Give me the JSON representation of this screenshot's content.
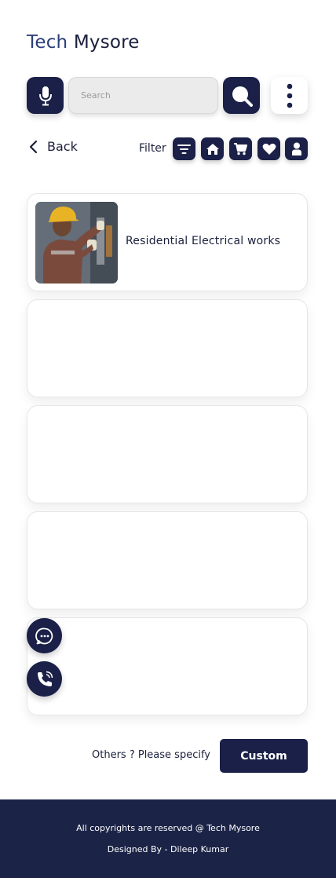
{
  "header": {
    "brand_part1": "Tech",
    "brand_part2": "Mysore"
  },
  "toolbar": {
    "mic_icon": "microphone-icon",
    "search_placeholder": "Search",
    "search_value": "",
    "search_icon": "search-icon",
    "more_icon": "vertical-dots-icon"
  },
  "nav": {
    "back_label": "Back",
    "filter_label": "Filter",
    "filter_buttons": [
      "filter-icon",
      "home-icon",
      "cart-icon",
      "heart-icon",
      "user-icon"
    ]
  },
  "cards": [
    {
      "title": "Residential Electrical works",
      "image": "electrician-photo"
    },
    {
      "title": ""
    },
    {
      "title": ""
    },
    {
      "title": ""
    },
    {
      "title": ""
    }
  ],
  "fabs": [
    "chat-icon",
    "phone-icon"
  ],
  "custom_section": {
    "prompt": "Others ? Please specify",
    "button_label": "Custom"
  },
  "footer": {
    "copyright": "All copyrights are reserved @ Tech Mysore",
    "designer": "Designed By - Dileep Kumar"
  },
  "colors": {
    "primary": "#1a2047",
    "brand_accent": "#2b3f7a",
    "footer_bg": "#1b2347"
  }
}
